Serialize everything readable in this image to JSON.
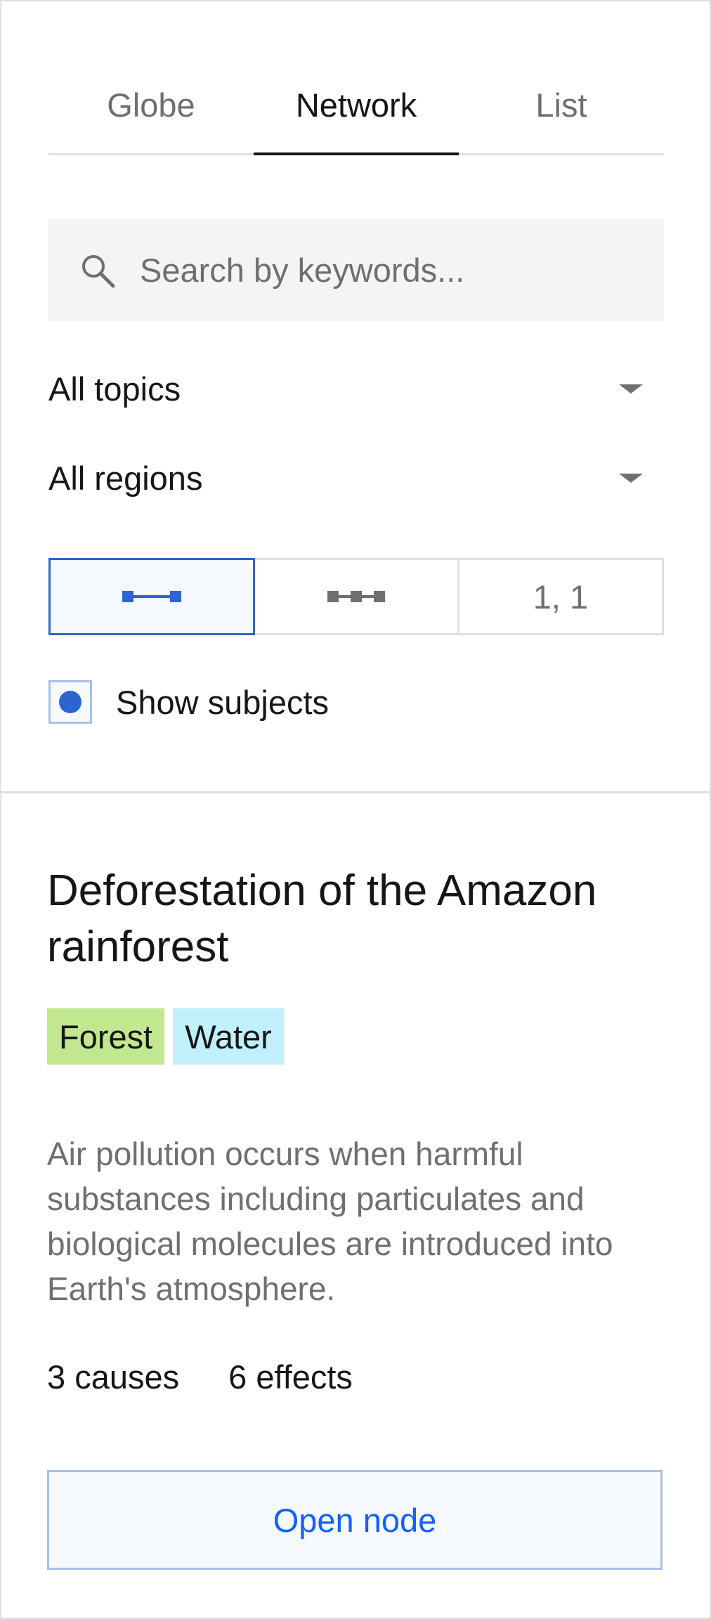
{
  "tabs": [
    {
      "label": "Globe",
      "active": false
    },
    {
      "label": "Network",
      "active": true
    },
    {
      "label": "List",
      "active": false
    }
  ],
  "search": {
    "placeholder": "Search by keywords...",
    "value": "",
    "icon": "search-icon"
  },
  "filters": {
    "topics": {
      "label": "All topics",
      "icon": "caret-down-icon"
    },
    "regions": {
      "label": "All regions",
      "icon": "caret-down-icon"
    }
  },
  "view_modes": [
    {
      "icon": "single-link-icon",
      "active": true
    },
    {
      "icon": "chain-link-icon",
      "active": false
    },
    {
      "label": "1, 1",
      "active": false
    }
  ],
  "show_subjects": {
    "label": "Show subjects",
    "checked": true
  },
  "node": {
    "title": "Deforestation of the Amazon rainforest",
    "tags": [
      {
        "label": "Forest",
        "color": "#c2e88f"
      },
      {
        "label": "Water",
        "color": "#c0f0fc"
      }
    ],
    "description": "Air pollution occurs when harmful substances including particulates and biological molecules are introduced into Earth's atmosphere.",
    "causes": "3 causes",
    "effects": "6 effects",
    "open_label": "Open node"
  },
  "colors": {
    "accent": "#2c65cf",
    "link": "#0f62fe",
    "border": "#e0e0e0",
    "muted": "#6f6f6f"
  }
}
